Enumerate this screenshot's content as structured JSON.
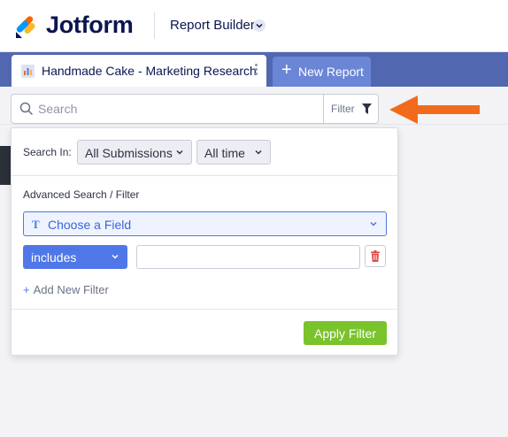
{
  "header": {
    "brand": "Jotform",
    "app_name": "Report Builder"
  },
  "tabs": {
    "active_label": "Handmade Cake - Marketing Research",
    "new_label": "New Report"
  },
  "search": {
    "placeholder": "Search",
    "value": "",
    "filter_label": "Filter"
  },
  "filter_panel": {
    "search_in_label": "Search In:",
    "submissions_select": "All Submissions",
    "time_select": "All time",
    "advanced_label": "Advanced Search / Filter",
    "field_select": "Choose a Field",
    "field_type_glyph": "T",
    "condition_select": "includes",
    "condition_value": "",
    "add_filter_label": "Add New Filter",
    "apply_label": "Apply Filter"
  },
  "colors": {
    "brand_navy": "#0a1551",
    "tab_bar": "#5168b0",
    "accent_blue": "#4f77e8",
    "apply_green": "#7ac32c",
    "arrow_orange": "#f26a1b",
    "delete_red": "#e04848"
  },
  "icons": [
    "jotform-logo-icon",
    "chevron-down-icon",
    "report-icon",
    "more-vertical-icon",
    "plus-icon",
    "search-icon",
    "filter-funnel-icon",
    "text-field-icon",
    "trash-icon",
    "arrow-left-annotation-icon"
  ]
}
